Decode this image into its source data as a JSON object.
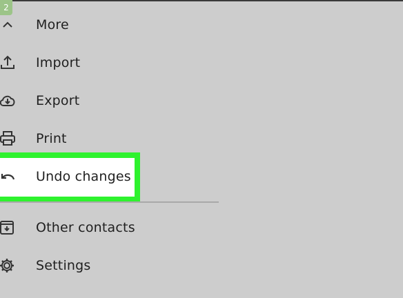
{
  "step_badge": "2",
  "menu": {
    "items": [
      {
        "label": "More",
        "icon": "chevron-up-icon"
      },
      {
        "label": "Import",
        "icon": "upload-icon"
      },
      {
        "label": "Export",
        "icon": "cloud-download-icon"
      },
      {
        "label": "Print",
        "icon": "printer-icon"
      },
      {
        "label": "Undo changes",
        "icon": "undo-icon",
        "highlighted": true
      },
      {
        "label": "Other contacts",
        "icon": "archive-icon"
      },
      {
        "label": "Settings",
        "icon": "gear-icon"
      }
    ]
  },
  "colors": {
    "background": "#cdcdcd",
    "highlight_border": "#2ef22e",
    "badge": "#9cc488",
    "text": "#1f1f1f"
  }
}
